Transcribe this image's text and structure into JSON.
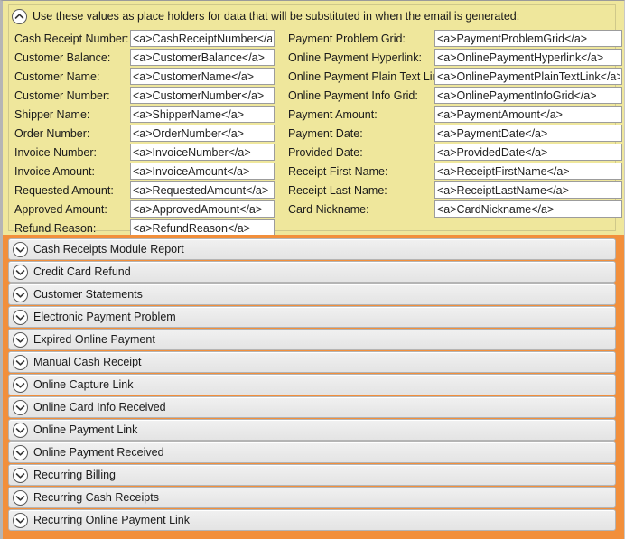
{
  "placeholder_panel": {
    "header": {
      "toggle_icon": "chevron-up-circle-icon",
      "text": "Use these values as place holders for data that will be substituted in when the email is generated:"
    },
    "background_color": "#efe79c",
    "left_fields": [
      {
        "label": "Cash Receipt Number:",
        "value": "<a>CashReceiptNumber</a>"
      },
      {
        "label": "Customer Balance:",
        "value": "<a>CustomerBalance</a>"
      },
      {
        "label": "Customer Name:",
        "value": "<a>CustomerName</a>"
      },
      {
        "label": "Customer Number:",
        "value": "<a>CustomerNumber</a>"
      },
      {
        "label": "Shipper Name:",
        "value": "<a>ShipperName</a>"
      },
      {
        "label": "Order Number:",
        "value": "<a>OrderNumber</a>"
      },
      {
        "label": "Invoice Number:",
        "value": "<a>InvoiceNumber</a>"
      },
      {
        "label": "Invoice Amount:",
        "value": "<a>InvoiceAmount</a>"
      },
      {
        "label": "Requested Amount:",
        "value": "<a>RequestedAmount</a>"
      },
      {
        "label": "Approved Amount:",
        "value": "<a>ApprovedAmount</a>"
      },
      {
        "label": "Refund Reason:",
        "value": "<a>RefundReason</a>"
      }
    ],
    "right_fields": [
      {
        "label": "Payment Problem Grid:",
        "value": "<a>PaymentProblemGrid</a>"
      },
      {
        "label": "Online Payment Hyperlink:",
        "value": "<a>OnlinePaymentHyperlink</a>"
      },
      {
        "label": "Online Payment Plain Text Link:",
        "value": "<a>OnlinePaymentPlainTextLink</a>"
      },
      {
        "label": "Online Payment Info Grid:",
        "value": "<a>OnlinePaymentInfoGrid</a>"
      },
      {
        "label": "Payment Amount:",
        "value": "<a>PaymentAmount</a>"
      },
      {
        "label": "Payment Date:",
        "value": "<a>PaymentDate</a>"
      },
      {
        "label": "Provided Date:",
        "value": "<a>ProvidedDate</a>"
      },
      {
        "label": "Receipt First Name:",
        "value": "<a>ReceiptFirstName</a>"
      },
      {
        "label": "Receipt Last Name:",
        "value": "<a>ReceiptLastName</a>"
      },
      {
        "label": "Card Nickname:",
        "value": "<a>CardNickname</a>"
      }
    ]
  },
  "accordion_panel": {
    "border_color": "#f28f3b",
    "toggle_icon": "chevron-down-circle-icon",
    "rows": [
      {
        "label": "Cash Receipts Module Report"
      },
      {
        "label": "Credit Card Refund"
      },
      {
        "label": "Customer Statements"
      },
      {
        "label": "Electronic Payment Problem"
      },
      {
        "label": "Expired Online Payment"
      },
      {
        "label": "Manual Cash Receipt"
      },
      {
        "label": "Online Capture Link"
      },
      {
        "label": "Online Card Info Received"
      },
      {
        "label": "Online Payment Link"
      },
      {
        "label": "Online Payment Received"
      },
      {
        "label": "Recurring Billing"
      },
      {
        "label": "Recurring Cash Receipts"
      },
      {
        "label": "Recurring Online Payment Link"
      }
    ]
  }
}
